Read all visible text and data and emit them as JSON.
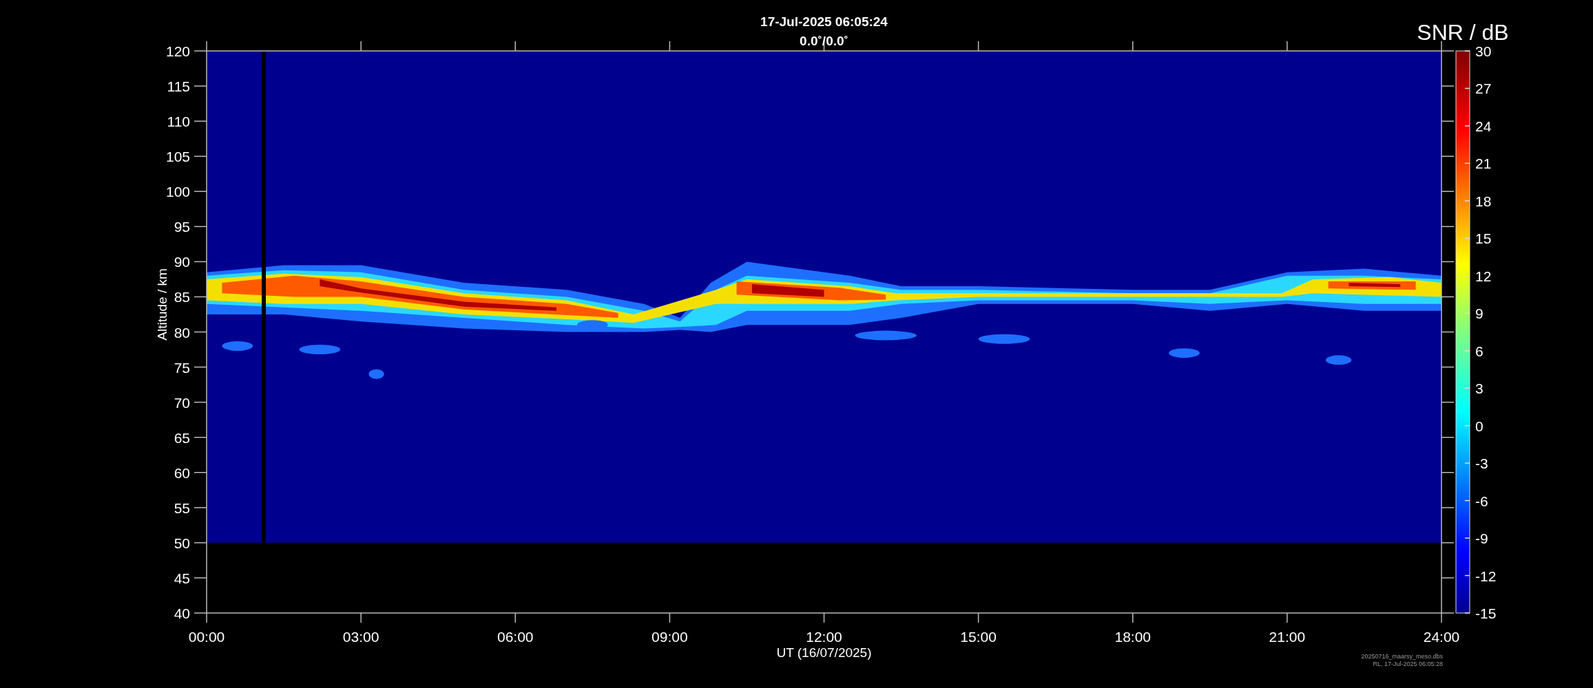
{
  "plot": {
    "title": "17-Jul-2025 06:05:24",
    "subtitle": "0.0˚/0.0˚",
    "y_axis": {
      "label": "Altitude / km",
      "ticks": [
        "120",
        "115",
        "110",
        "105",
        "100",
        "95",
        "90",
        "85",
        "80",
        "75",
        "70",
        "65",
        "60",
        "55",
        "50",
        "45",
        "40"
      ]
    },
    "x_axis": {
      "label": "UT (16/07/2025)",
      "ticks": [
        "00:00",
        "03:00",
        "06:00",
        "09:00",
        "12:00",
        "15:00",
        "18:00",
        "21:00",
        "24:00"
      ]
    },
    "colorbar": {
      "title": "SNR / dB",
      "ticks": [
        "30",
        "27",
        "24",
        "21",
        "18",
        "15",
        "12",
        "9",
        "6",
        "3",
        "0",
        "-3",
        "-6",
        "-9",
        "-12",
        "-15"
      ]
    }
  },
  "footer": [
    "20250716_maarsy_meso.dbs",
    "RL, 17-Jul-2025 06:05:28"
  ]
}
